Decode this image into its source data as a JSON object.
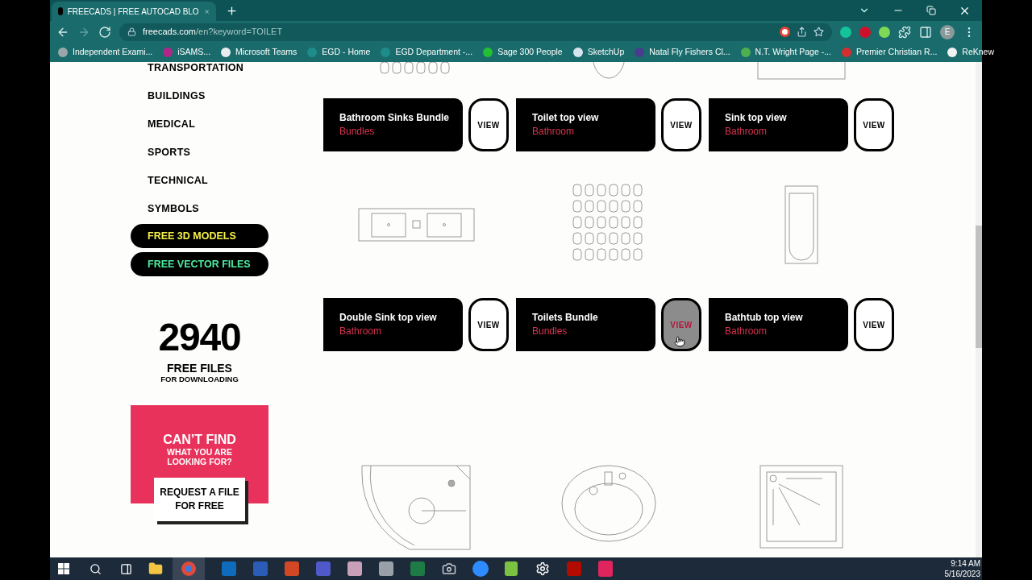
{
  "browser": {
    "tab_title": "FREECADS | FREE AUTOCAD BLO",
    "url_host": "freecads.com",
    "url_path": "/en?keyword=TOILET",
    "profile_initial": "E",
    "bookmarks": [
      {
        "label": "Independent Exami...",
        "color": "#9aa7a8"
      },
      {
        "label": "iSAMS...",
        "color": "#b0278a"
      },
      {
        "label": "Microsoft Teams",
        "color": "#e8eef0"
      },
      {
        "label": "EGD - Home",
        "color": "#1e8c8a"
      },
      {
        "label": "EGD Department -...",
        "color": "#1e8c8a"
      },
      {
        "label": "Sage 300 People",
        "color": "#22c033"
      },
      {
        "label": "SketchUp",
        "color": "#d6e4ee"
      },
      {
        "label": "Natal Fly Fishers Cl...",
        "color": "#4a3c8c"
      },
      {
        "label": "N.T. Wright Page -...",
        "color": "#4caf50"
      },
      {
        "label": "Premier Christian R...",
        "color": "#d32f2f"
      },
      {
        "label": "ReKnew",
        "color": "#f2f2f2"
      }
    ]
  },
  "sidebar": {
    "categories": [
      "TRANSPORTATION",
      "BUILDINGS",
      "MEDICAL",
      "SPORTS",
      "TECHNICAL",
      "SYMBOLS"
    ],
    "pills": [
      {
        "label": "FREE 3D MODELS",
        "kind": "models"
      },
      {
        "label": "FREE VECTOR FILES",
        "kind": "vectors"
      }
    ],
    "count": "2940",
    "count_label": "FREE FILES",
    "count_sub": "FOR DOWNLOADING",
    "promo": {
      "title": "CAN’T FIND",
      "subtitle": "WHAT YOU ARE LOOKING FOR?",
      "button": "REQUEST A FILE FOR FREE"
    }
  },
  "thumbnail_rows": [
    [
      {
        "kind": "toilets-set"
      },
      {
        "kind": "round-basin"
      },
      {
        "kind": "wide-rect"
      }
    ],
    [
      {
        "kind": "double-sink"
      },
      {
        "kind": "toilets-set"
      },
      {
        "kind": "bathtub"
      }
    ],
    [
      {
        "kind": "corner-shower"
      },
      {
        "kind": "oval-sink"
      },
      {
        "kind": "square-shower"
      }
    ]
  ],
  "card_rows": [
    [
      {
        "name": "Bathroom Sinks Bundle",
        "category": "Bundles",
        "view": "VIEW",
        "hovered": false
      },
      {
        "name": "Toilet top view",
        "category": "Bathroom",
        "view": "VIEW",
        "hovered": false
      },
      {
        "name": "Sink top view",
        "category": "Bathroom",
        "view": "VIEW",
        "hovered": false
      }
    ],
    [
      {
        "name": "Double Sink top view",
        "category": "Bathroom",
        "view": "VIEW",
        "hovered": false
      },
      {
        "name": "Toilets Bundle",
        "category": "Bundles",
        "view": "VIEW",
        "hovered": true
      },
      {
        "name": "Bathtub top view",
        "category": "Bathroom",
        "view": "VIEW",
        "hovered": false
      }
    ]
  ],
  "taskbar": {
    "time": "9:14 AM",
    "date": "5/16/2023"
  }
}
